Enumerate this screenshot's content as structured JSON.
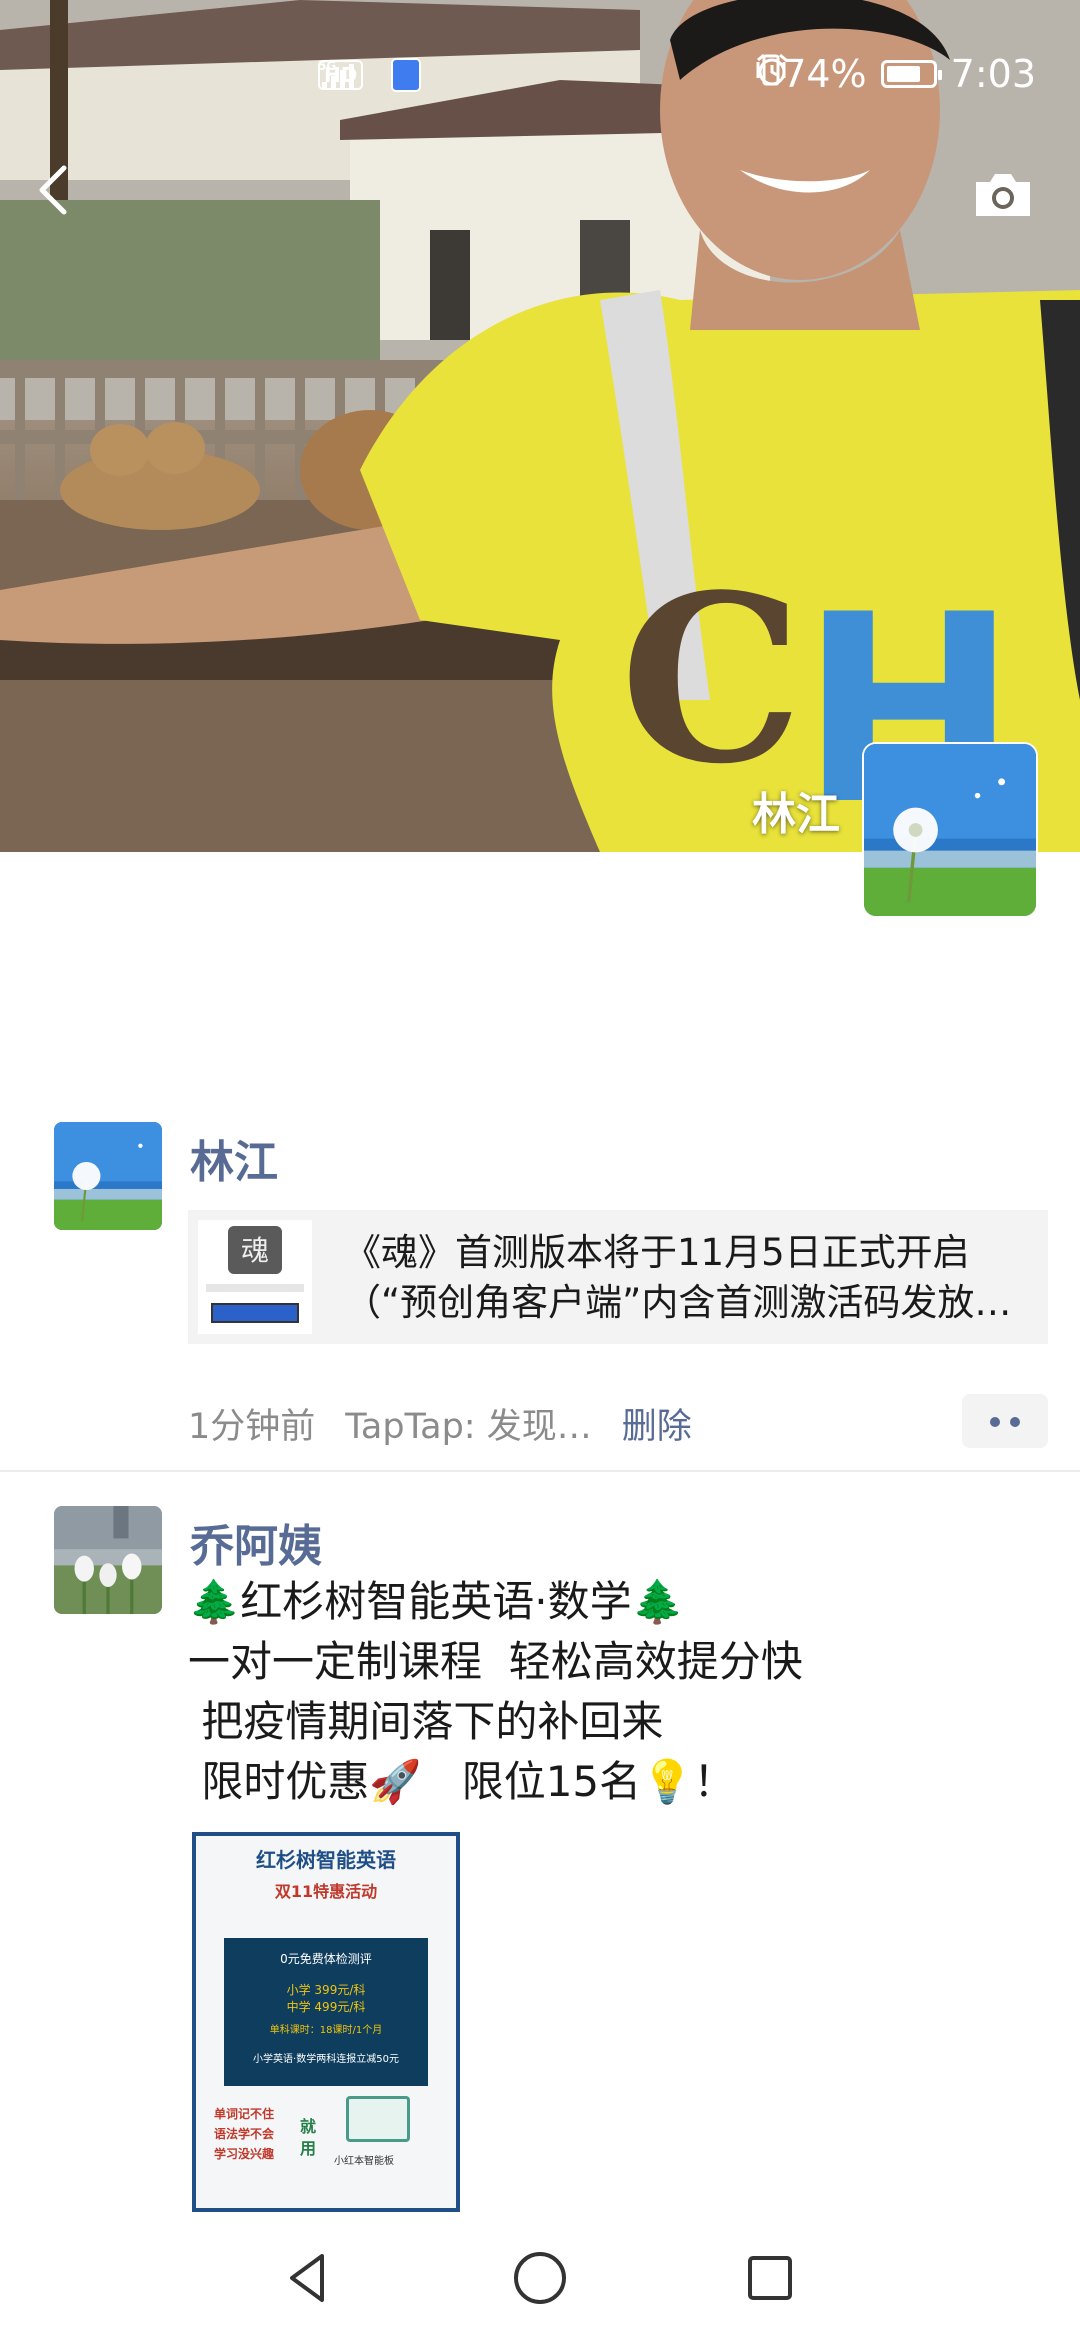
{
  "status_bar": {
    "hd": "HD",
    "network": "5G",
    "battery_percent": "74%",
    "battery_level": 0.74,
    "time": "7:03"
  },
  "cover": {
    "user_name": "林江",
    "back_icon": "chevron-left-icon",
    "camera_icon": "camera-icon"
  },
  "posts": [
    {
      "author": "林江",
      "link_title": "《魂》首测版本将于11月5日正式开启（“预创角客户端”内含首测激活码发放…",
      "link_line1": "《魂》首测版本将于11月5日正式开启",
      "link_line2": "（“预创角客户端”内含首测激活码发放…",
      "time": "1分钟前",
      "source": "TapTap: 发现…",
      "delete_label": "删除"
    },
    {
      "author": "乔阿姨",
      "text": "🌲红杉树智能英语·数学🌲\n一对一定制课程  轻松高效提分快\n 把疫情期间落下的补回来\n 限时优惠🚀   限位15名💡！",
      "poster": {
        "title": "红杉树智能英语",
        "subtitle": "双11特惠活动",
        "free": "0元免费体检测评",
        "primary": "小学  399元/科",
        "middle": "中学  499元/科",
        "hours": "单科课时：18课时/1个月",
        "combo": "小学英语·数学两科连报立减50元",
        "side": "单词记不住\n语法学不会\n学习没兴趣",
        "use": "就\n用",
        "device": "小红本智能板"
      }
    }
  ],
  "nav": {
    "back": "triangle-back-icon",
    "home": "circle-home-icon",
    "recent": "square-recent-icon"
  }
}
